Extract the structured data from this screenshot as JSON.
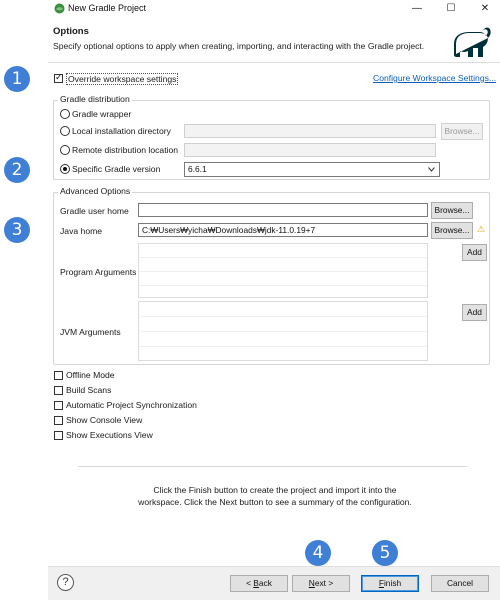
{
  "window": {
    "title": "New Gradle Project",
    "controls": {
      "minimize": "—",
      "maximize": "☐",
      "close": "✕"
    }
  },
  "header": {
    "title": "Options",
    "description": "Specify optional options to apply when creating, importing, and interacting with the Gradle project."
  },
  "callouts": [
    "1",
    "2",
    "3",
    "4",
    "5"
  ],
  "override": {
    "label": "Override workspace settings",
    "checked": true,
    "link": "Configure Workspace Settings..."
  },
  "distribution": {
    "group_title": "Gradle distribution",
    "options": [
      {
        "label": "Gradle wrapper",
        "selected": false
      },
      {
        "label": "Local installation directory",
        "selected": false
      },
      {
        "label": "Remote distribution location",
        "selected": false
      },
      {
        "label": "Specific Gradle version",
        "selected": true
      }
    ],
    "browse_label": "Browse...",
    "version_value": "6.6.1"
  },
  "advanced": {
    "group_title": "Advanced Options",
    "user_home_label": "Gradle user home",
    "user_home_value": "",
    "java_home_label": "Java home",
    "java_home_value": "C:₩Users₩yicha₩Downloads₩jdk-11.0.19+7",
    "browse_label": "Browse...",
    "program_args_label": "Program Arguments",
    "jvm_args_label": "JVM Arguments",
    "add_label": "Add"
  },
  "checkboxes": [
    {
      "label": "Offline Mode",
      "checked": false
    },
    {
      "label": "Build Scans",
      "checked": false
    },
    {
      "label": "Automatic Project Synchronization",
      "checked": false
    },
    {
      "label": "Show Console View",
      "checked": false
    },
    {
      "label": "Show Executions View",
      "checked": false
    }
  ],
  "info": {
    "line1": "Click the Finish button to create the project and import it into the",
    "line2": "workspace. Click the Next button to see a summary of the configuration."
  },
  "footer": {
    "help": "?",
    "back_prefix": "< ",
    "back_mnemonic": "B",
    "back_rest": "ack",
    "next_mnemonic": "N",
    "next_rest": "ext >",
    "finish_mnemonic": "F",
    "finish_rest": "inish",
    "cancel_label": "Cancel"
  },
  "colors": {
    "callout": "#3f7fd6",
    "link": "#0b5eb8",
    "warning": "#e0a800"
  },
  "icons": {
    "app": "gradle-eclipse-icon",
    "logo": "gradle-elephant-icon",
    "warning": "warning-icon",
    "help": "help-icon",
    "chevron": "chevron-down-icon"
  }
}
